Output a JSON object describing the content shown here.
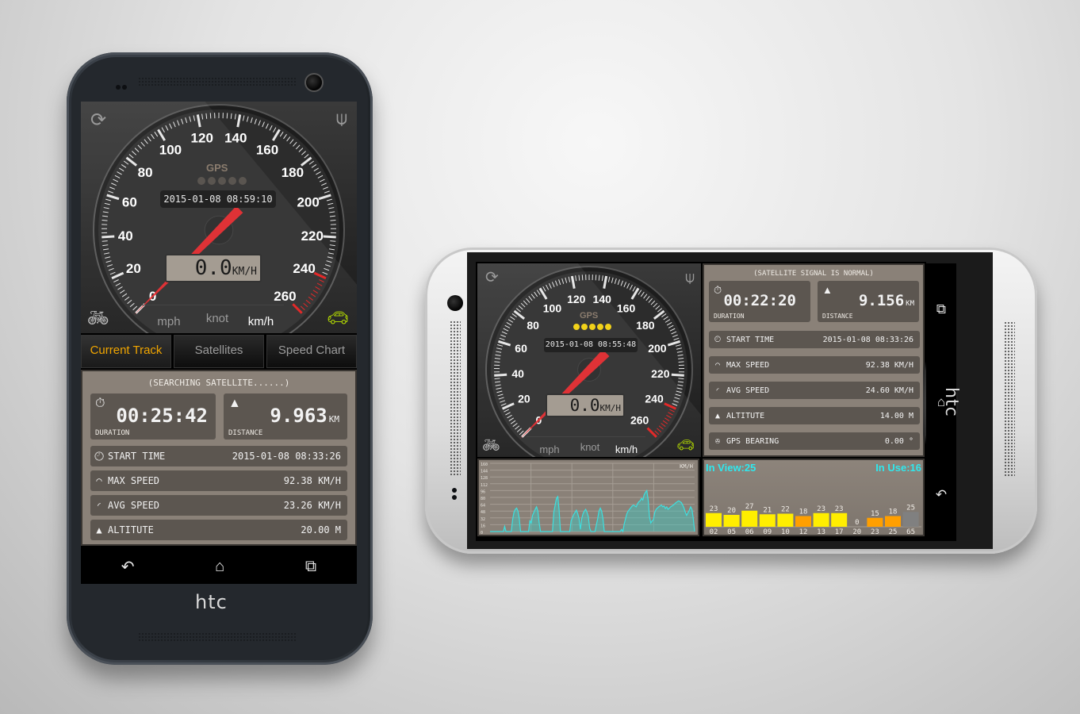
{
  "portrait": {
    "gauge": {
      "tick_labels": [
        "0",
        "20",
        "40",
        "60",
        "80",
        "100",
        "120",
        "140",
        "160",
        "180",
        "200",
        "220",
        "240",
        "260"
      ],
      "gps_label": "GPS",
      "gps_dots_active": 0,
      "gps_dots_total": 5,
      "datetime": "2015-01-08 08:59:10",
      "speed_value": "0.0",
      "speed_unit": "KM/H",
      "needle_speed": 0,
      "refresh_icon": "refresh-icon",
      "joystick_icon": "joystick-icon",
      "bike_icon": "bicycle-icon",
      "car_icon": "car-icon",
      "accent_car": "#b8e000",
      "unit_tabs": [
        {
          "label": "mph",
          "selected": false
        },
        {
          "label": "knot",
          "selected": false
        },
        {
          "label": "km/h",
          "selected": true
        }
      ]
    },
    "tabs": [
      {
        "label": "Current Track",
        "selected": true
      },
      {
        "label": "Satellites",
        "selected": false
      },
      {
        "label": "Speed Chart",
        "selected": false
      }
    ],
    "status": "(SEARCHING SATELLITE......)",
    "duration": {
      "value": "00:25:42",
      "caption": "DURATION",
      "icon": "stopwatch-icon"
    },
    "distance": {
      "value": "9.963",
      "unit": "KM",
      "caption": "DISTANCE",
      "icon": "road-icon"
    },
    "rows": [
      {
        "label": "START TIME",
        "value": "2015-01-08 08:33:26",
        "icon": "clock-icon"
      },
      {
        "label": "MAX SPEED",
        "value": "92.38 KM/H",
        "icon": "max-speed-icon"
      },
      {
        "label": "AVG SPEED",
        "value": "23.26 KM/H",
        "icon": "avg-speed-icon"
      },
      {
        "label": "ALTITUTE",
        "value": "20.00 M",
        "icon": "mountain-icon"
      }
    ],
    "nav": {
      "back": "↶",
      "home": "⌂",
      "recent": "⧉"
    },
    "brand": "htc"
  },
  "landscape": {
    "gauge": {
      "tick_labels": [
        "0",
        "20",
        "40",
        "60",
        "80",
        "100",
        "120",
        "140",
        "160",
        "180",
        "200",
        "220",
        "240",
        "260"
      ],
      "gps_label": "GPS",
      "gps_dots_active": 5,
      "gps_dots_total": 5,
      "datetime": "2015-01-08 08:55:48",
      "speed_value": "0.0",
      "speed_unit": "KM/H",
      "needle_speed": 0,
      "accent_car": "#b8e000",
      "gps_dot_color": "#f2d21a",
      "unit_tabs": [
        {
          "label": "mph",
          "selected": false
        },
        {
          "label": "knot",
          "selected": false
        },
        {
          "label": "km/h",
          "selected": true
        }
      ]
    },
    "status": "(SATELLITE SIGNAL IS NORMAL)",
    "duration": {
      "value": "00:22:20",
      "caption": "DURATION"
    },
    "distance": {
      "value": "9.156",
      "unit": "KM",
      "caption": "DISTANCE"
    },
    "rows": [
      {
        "label": "START TIME",
        "value": "2015-01-08 08:33:26",
        "icon": "clock-icon"
      },
      {
        "label": "MAX SPEED",
        "value": "92.38 KM/H",
        "icon": "max-speed-icon"
      },
      {
        "label": "AVG SPEED",
        "value": "24.60 KM/H",
        "icon": "avg-speed-icon"
      },
      {
        "label": "ALTITUTE",
        "value": "14.00 M",
        "icon": "mountain-icon"
      },
      {
        "label": "GPS BEARING",
        "value": "0.00 °",
        "icon": "compass-icon"
      }
    ],
    "speed_chart": {
      "type": "area",
      "unit_label": "KM/H",
      "y_ticks": [
        "0",
        "16",
        "32",
        "48",
        "64",
        "80",
        "96",
        "112",
        "128",
        "144",
        "160"
      ],
      "ylim": [
        0,
        160
      ],
      "color": "#3cc8c0",
      "values": [
        0,
        0,
        0,
        0,
        0,
        0,
        0,
        0,
        0,
        0,
        0,
        12,
        0,
        0,
        0,
        0,
        0,
        28,
        45,
        52,
        55,
        48,
        30,
        0,
        0,
        0,
        0,
        0,
        0,
        0,
        25,
        20,
        38,
        45,
        52,
        58,
        48,
        20,
        0,
        0,
        0,
        0,
        0,
        0,
        0,
        0,
        0,
        0,
        45,
        62,
        78,
        82,
        50,
        0,
        0,
        0,
        0,
        0,
        0,
        0,
        0,
        25,
        32,
        40,
        45,
        50,
        42,
        30,
        5,
        30,
        42,
        48,
        52,
        45,
        35,
        8,
        0,
        0,
        0,
        0,
        15,
        30,
        48,
        55,
        48,
        30,
        0,
        0,
        0,
        0,
        0,
        0,
        0,
        0,
        0,
        0,
        0,
        0,
        0,
        5,
        0,
        18,
        30,
        42,
        48,
        52,
        56,
        60,
        62,
        60,
        58,
        65,
        70,
        72,
        78,
        74,
        86,
        92,
        96,
        75,
        35,
        20,
        25,
        28,
        45,
        52,
        55,
        58,
        60,
        62,
        58,
        60,
        54,
        58,
        52,
        55,
        58,
        60,
        62,
        65,
        68,
        70,
        72,
        70,
        68,
        62,
        55,
        45,
        38,
        44,
        50,
        58,
        52,
        30,
        0
      ]
    },
    "satellites": {
      "in_view_label": "In View:25",
      "in_use_label": "In Use:16",
      "bars": [
        {
          "id": "02",
          "snr": 23,
          "color": "#ffee00"
        },
        {
          "id": "05",
          "snr": 20,
          "color": "#ffee00"
        },
        {
          "id": "06",
          "snr": 27,
          "color": "#ffee00"
        },
        {
          "id": "09",
          "snr": 21,
          "color": "#ffee00"
        },
        {
          "id": "10",
          "snr": 22,
          "color": "#ffee00"
        },
        {
          "id": "12",
          "snr": 18,
          "color": "#ff9f00"
        },
        {
          "id": "13",
          "snr": 23,
          "color": "#ffee00"
        },
        {
          "id": "17",
          "snr": 23,
          "color": "#ffee00"
        },
        {
          "id": "20",
          "snr": 0,
          "color": "#ff9f00"
        },
        {
          "id": "23",
          "snr": 15,
          "color": "#ff9f00"
        },
        {
          "id": "25",
          "snr": 18,
          "color": "#ff9f00"
        },
        {
          "id": "65",
          "snr": 25,
          "color": "#808080"
        }
      ]
    },
    "nav": {
      "back": "↶",
      "home": "⌂",
      "recent": "⧉"
    },
    "brand": "htc"
  }
}
